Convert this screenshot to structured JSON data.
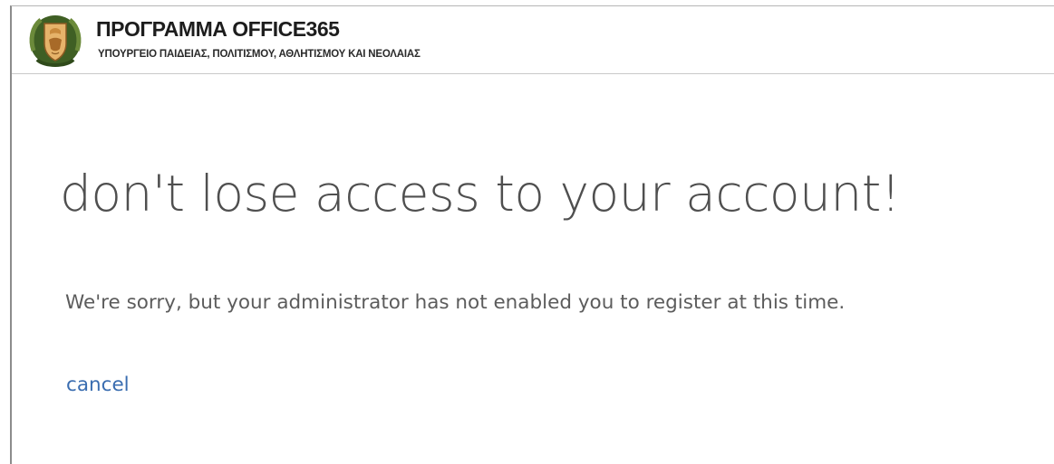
{
  "header": {
    "title": "ΠΡΟΓΡΑΜΜΑ OFFICE365",
    "subtitle": "ΥΠΟΥΡΓΕΙΟ ΠΑΙΔΕΙΑΣ, ΠΟΛΙΤΙΣΜΟΥ, ΑΘΛΗΤΙΣΜΟΥ ΚΑΙ ΝΕΟΛΑΙΑΣ",
    "logo_icon": "coat-of-arms-logo"
  },
  "main": {
    "headline": "don't lose access to your account!",
    "message": "We're sorry, but your administrator has not enabled you to register at this time.",
    "cancel_label": "cancel"
  },
  "colors": {
    "link": "#3a6db0",
    "headline": "#4f4f4f",
    "body_text": "#5c5c5c",
    "logo_olive": "#4a6a2c",
    "logo_copper": "#c98a3c"
  }
}
